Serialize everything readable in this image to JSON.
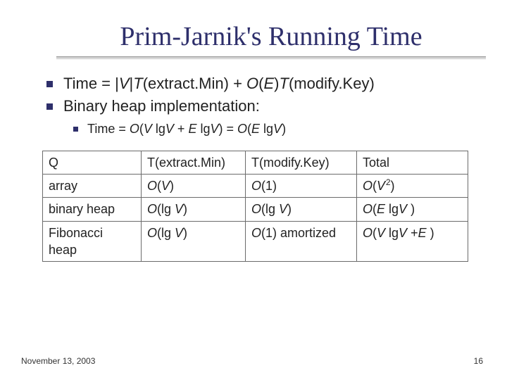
{
  "title": "Prim-Jarnik's Running Time",
  "bullets_level1": [
    {
      "pre": "Time = |",
      "v": "V",
      "mid1": "|",
      "t1": "T",
      "mid2": "(extract.Min) + ",
      "o": "O",
      "lp": "(",
      "e": "E",
      "rp": ")",
      "t2": "T",
      "post": "(modify.Key)"
    },
    {
      "text": "Binary heap implementation:"
    }
  ],
  "bullet_level2": {
    "pre": "Time = ",
    "o1": "O",
    "m1": "(",
    "v1": "V",
    "m2": " lg",
    "v2": "V",
    "m3": " + ",
    "e": "E",
    "m4": " lg",
    "v3": "V",
    "m5": ") = ",
    "o2": "O",
    "m6": "(",
    "e2": "E",
    "m7": " lg",
    "v4": "V",
    "m8": ")"
  },
  "table": {
    "header": {
      "c0": "Q",
      "c1": "T(extract.Min)",
      "c2": "T(modify.Key)",
      "c3": "Total"
    },
    "rows": [
      {
        "c0": "array",
        "c1": {
          "o": "O",
          "l": "(",
          "v": "V",
          "r": ")"
        },
        "c2": {
          "o": "O",
          "l": "(1)",
          "v": "",
          "r": ""
        },
        "c3": {
          "o": "O",
          "l": "(",
          "v": "V",
          "sup": "2",
          "r": ")"
        }
      },
      {
        "c0": "binary heap",
        "c1": {
          "o": "O",
          "text": "(lg ",
          "v": "V",
          "r": ")"
        },
        "c2": {
          "o": "O",
          "text": "(lg ",
          "v": "V",
          "r": ")"
        },
        "c3": {
          "o": "O",
          "l": "(",
          "e": "E",
          "m": " lg",
          "v": "V",
          "r": " )"
        }
      },
      {
        "c0": "Fibonacci heap",
        "c1": {
          "o": "O",
          "text": "(lg ",
          "v": "V",
          "r": ")"
        },
        "c2": {
          "o": "O",
          "text": "(1) amortized"
        },
        "c3": {
          "o": "O",
          "l": "(",
          "v": "V",
          "m": " lg",
          "v2": "V",
          "plus": " +",
          "e": "E",
          "r": " )"
        }
      }
    ]
  },
  "footer_date": "November 13, 2003",
  "page_number": "16"
}
